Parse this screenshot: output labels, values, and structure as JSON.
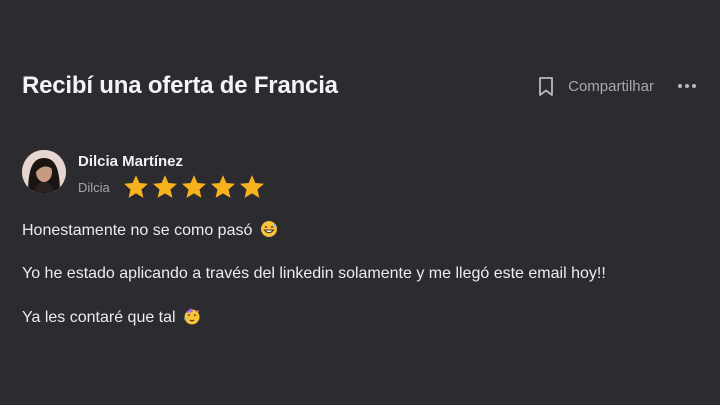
{
  "post": {
    "title": "Recibí una oferta de Francia",
    "share_label": "Compartilhar"
  },
  "author": {
    "name": "Dilcia Martínez",
    "handle": "Dilcia",
    "rating": 5,
    "rating_max": 5
  },
  "content": {
    "paragraphs": [
      {
        "text": "Honestamente no se como pasó",
        "emoji": "grinning-sweat-emoji"
      },
      {
        "text": "Yo he estado aplicando a través del linkedin solamente y me llegó este email hoy!!"
      },
      {
        "text": "Ya les contaré que tal",
        "emoji": "partying-face-emoji"
      }
    ]
  },
  "colors": {
    "background": "#2b2b30",
    "star": "#f7b11c",
    "text": "#ededf0",
    "muted": "#a7a7ad"
  },
  "icons": {
    "bookmark": "bookmark-icon",
    "more": "more-options-icon",
    "star": "star-icon"
  }
}
